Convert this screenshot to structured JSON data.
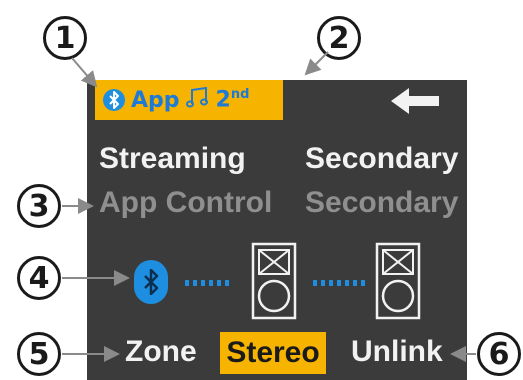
{
  "callouts": {
    "c1": "1",
    "c2": "2",
    "c3": "3",
    "c4": "4",
    "c5": "5",
    "c6": "6"
  },
  "status": {
    "source_label": "App",
    "rank_number": "2",
    "rank_suffix": "nd"
  },
  "labels": {
    "streaming": "Streaming",
    "secondary_top": "Secondary",
    "app_control": "App Control",
    "secondary_bottom": "Secondary"
  },
  "buttons": {
    "zone": "Zone",
    "stereo": "Stereo",
    "unlink": "Unlink"
  },
  "icons": {
    "bluetooth": "bluetooth-icon",
    "note": "music-note-icon",
    "back": "back-arrow-icon",
    "speaker": "speaker-icon"
  },
  "colors": {
    "screen_bg": "#3b3b3b",
    "accent_yellow": "#f6b400",
    "bluetooth_blue": "#1e8fe0",
    "text_white": "#f2f2f2",
    "text_grey": "#8f8f8f"
  }
}
